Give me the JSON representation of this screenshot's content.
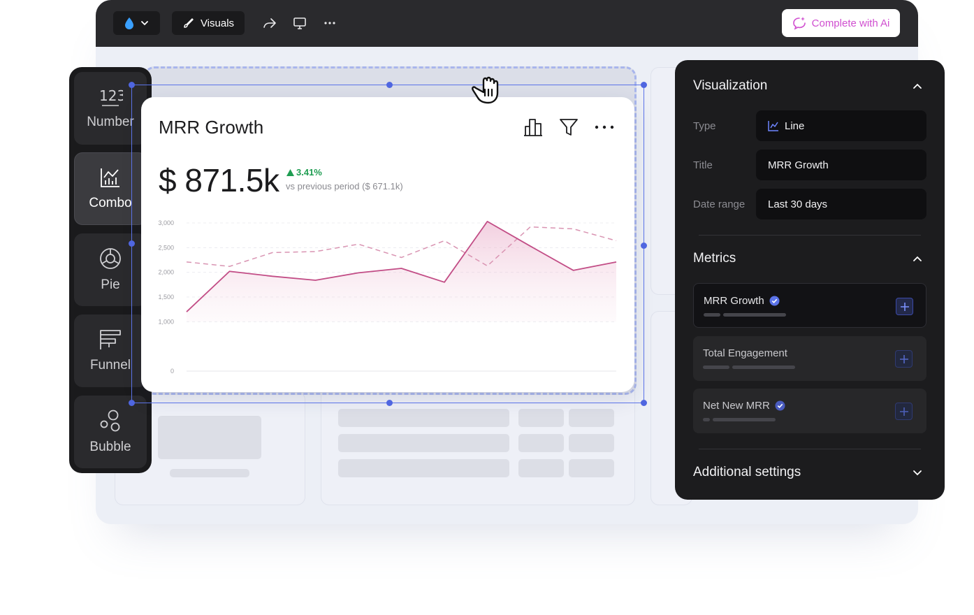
{
  "topbar": {
    "visuals_label": "Visuals",
    "ai_label": "Complete with Ai",
    "icons": [
      "drop-icon",
      "chevron-down-icon",
      "brush-icon",
      "share-icon",
      "present-icon",
      "more-icon"
    ]
  },
  "sidebar": {
    "items": [
      {
        "label": "Number",
        "icon": "number-icon"
      },
      {
        "label": "Combo",
        "icon": "combo-chart-icon",
        "active": true
      },
      {
        "label": "Pie",
        "icon": "pie-icon"
      },
      {
        "label": "Funnel",
        "icon": "funnel-icon"
      },
      {
        "label": "Bubble",
        "icon": "bubble-icon"
      }
    ]
  },
  "card": {
    "title": "MRR Growth",
    "value": "$ 871.5k",
    "change": "3.41%",
    "compare": "vs previous period ($ 671.1k)"
  },
  "chart_data": {
    "type": "line",
    "y_ticks": [
      "3,000",
      "2,500",
      "2,000",
      "1,500",
      "1,000",
      "0"
    ],
    "ylim": [
      0,
      3000
    ],
    "grid": true,
    "series": [
      {
        "style": "solid",
        "color": "#c24d86",
        "values": [
          1200,
          2020,
          1920,
          1840,
          1990,
          2080,
          1800,
          3030,
          2530,
          2040,
          2210
        ]
      },
      {
        "style": "dashed",
        "color": "#d994b2",
        "values": [
          2210,
          2120,
          2400,
          2420,
          2570,
          2300,
          2640,
          2130,
          2920,
          2880,
          2640
        ]
      }
    ],
    "x": [
      0,
      1,
      2,
      3,
      4,
      5,
      6,
      7,
      8,
      9,
      10
    ]
  },
  "panel": {
    "visualization_title": "Visualization",
    "type_label": "Type",
    "type_value": "Line",
    "title_label": "Title",
    "title_value": "MRR Growth",
    "date_label": "Date range",
    "date_value": "Last 30 days",
    "metrics_title": "Metrics",
    "metrics": [
      {
        "name": "MRR Growth",
        "verified": true
      },
      {
        "name": "Total Engagement",
        "verified": false
      },
      {
        "name": "Net New MRR",
        "verified": true
      }
    ],
    "additional_title": "Additional settings"
  },
  "colors": {
    "accent": "#5b73e8",
    "positive": "#1f9d52",
    "ai": "#d04fd0",
    "series_main": "#c24d86"
  }
}
